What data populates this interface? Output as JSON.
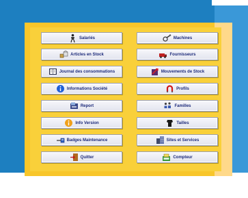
{
  "menu": {
    "left": [
      {
        "label": "Salariés",
        "icon": "worker-icon"
      },
      {
        "label": "Articles en Stock",
        "icon": "boxes-icon"
      },
      {
        "label": "Journal des consommations",
        "icon": "journal-icon"
      },
      {
        "label": "Informations Société",
        "icon": "info-icon"
      },
      {
        "label": "Report",
        "icon": "report-icon"
      },
      {
        "label": "Info Version",
        "icon": "version-info-icon"
      },
      {
        "label": "Badges Maintenance",
        "icon": "badge-icon"
      },
      {
        "label": "Quitter",
        "icon": "exit-icon"
      }
    ],
    "right": [
      {
        "label": "Machines",
        "icon": "machine-icon"
      },
      {
        "label": "Fournisseurs",
        "icon": "supplier-icon"
      },
      {
        "label": "Mouvements de Stock",
        "icon": "stock-movement-icon"
      },
      {
        "label": "Profils",
        "icon": "magnet-icon"
      },
      {
        "label": "Familles",
        "icon": "family-icon"
      },
      {
        "label": "Tailles",
        "icon": "size-icon"
      },
      {
        "label": "Sites et Services",
        "icon": "building-icon"
      },
      {
        "label": "Compteur",
        "icon": "counter-icon"
      }
    ]
  },
  "colors": {
    "background_blue": "#1d7fc0",
    "frame_yellow": "#f8c62a",
    "button_face": "#eceef5",
    "label_text": "#1c2a7a"
  }
}
